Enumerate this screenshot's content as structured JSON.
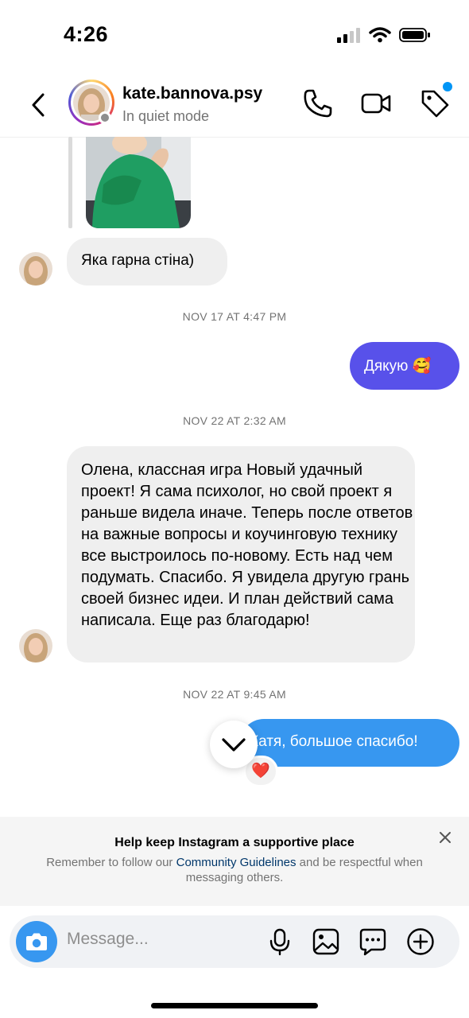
{
  "status_bar": {
    "time": "4:26"
  },
  "header": {
    "username": "kate.bannova.psy",
    "subtitle": "In quiet mode"
  },
  "messages": {
    "incoming_1": "Яка гарна стіна)",
    "timestamp_1": "NOV 17 AT 4:47 PM",
    "outgoing_1": "Дякую 🥰",
    "timestamp_2": "NOV 22 AT 2:32 AM",
    "incoming_2": "Олена, классная игра Новый удачный проект! Я сама психолог, но свой проект я раньше видела иначе. Теперь после ответов на важные вопросы и коучинговую технику все выстроилось по-новому. Есть над чем подумать. Спасибо. Я увидела другую грань своей бизнес идеи. И план действий сама написала. Еще раз благодарю!",
    "timestamp_3": "NOV 22 AT 9:45 AM",
    "outgoing_2": "Катя, большое спасибо!",
    "reaction": "❤️"
  },
  "banner": {
    "title": "Help keep Instagram a supportive place",
    "text_before": "Remember to follow our ",
    "link": "Community Guidelines",
    "text_after": " and be respectful when messaging others."
  },
  "composer": {
    "placeholder": "Message..."
  },
  "icons": {
    "back": "chevron-left-icon",
    "call": "phone-icon",
    "video": "video-camera-icon",
    "tag": "tag-icon",
    "scroll": "chevron-down-icon",
    "camera": "camera-icon",
    "mic": "microphone-icon",
    "gallery": "image-icon",
    "sticker": "chat-bubble-icon",
    "add": "plus-circle-icon"
  },
  "colors": {
    "outgoing_bubble": "#5851ea",
    "outgoing_bubble_recent": "#3797f0",
    "incoming_bubble": "#efefef",
    "accent": "#0095f6"
  }
}
